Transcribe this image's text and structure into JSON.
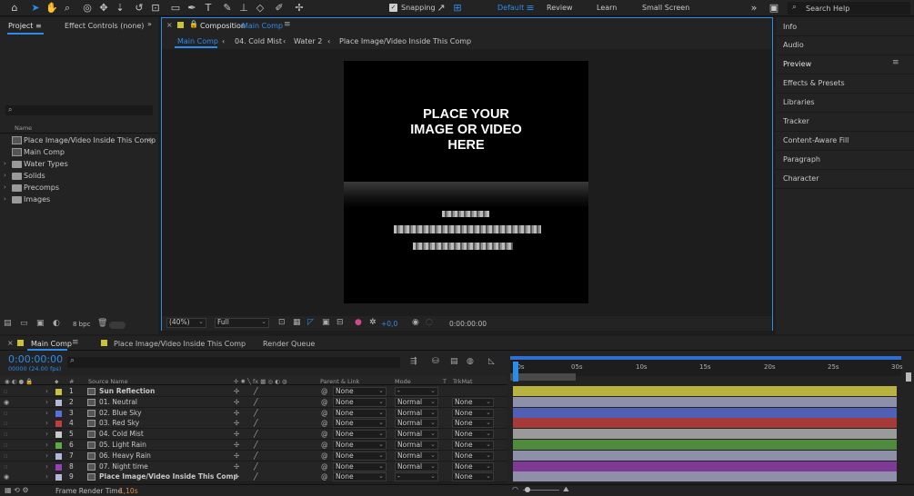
{
  "toolbar": {
    "snapping_label": "Snapping",
    "workspaces": [
      "Default",
      "Review",
      "Learn",
      "Small Screen"
    ],
    "search_placeholder": "Search Help"
  },
  "project": {
    "tab_project": "Project",
    "tab_effect_controls": "Effect Controls (none)",
    "column_name": "Name",
    "items": [
      {
        "label": "Place Image/Video Inside This Comp",
        "type": "comp"
      },
      {
        "label": "Main Comp",
        "type": "comp"
      },
      {
        "label": "Water Types",
        "type": "folder"
      },
      {
        "label": "Solids",
        "type": "folder"
      },
      {
        "label": "Precomps",
        "type": "folder"
      },
      {
        "label": "Images",
        "type": "folder"
      }
    ],
    "bpc": "8 bpc"
  },
  "composition": {
    "tab_prefix": "Composition",
    "tab_name": "Main Comp",
    "breadcrumbs": [
      "Main Comp",
      "04. Cold Mist",
      "Water 2",
      "Place Image/Video Inside This Comp"
    ],
    "placeholder_lines": [
      "PLACE YOUR",
      "IMAGE OR VIDEO",
      "HERE"
    ],
    "zoom": "(40%)",
    "resolution": "Full",
    "exposure": "+0,0",
    "timecode": "0:00:00:00"
  },
  "right_panels": [
    "Info",
    "Audio",
    "Preview",
    "Effects & Presets",
    "Libraries",
    "Tracker",
    "Content-Aware Fill",
    "Paragraph",
    "Character"
  ],
  "timeline": {
    "tabs": [
      "Main Comp",
      "Place Image/Video Inside This Comp",
      "Render Queue"
    ],
    "timecode": "0:00:00:00",
    "frames": "00000 (24.00 fps)",
    "ruler_labels": [
      "00s",
      "05s",
      "10s",
      "15s",
      "20s",
      "25s",
      "30s"
    ],
    "columns": {
      "hash": "#",
      "source_name": "Source Name",
      "parent": "Parent & Link",
      "mode": "Mode",
      "t": "T",
      "trkmat": "TrkMat"
    },
    "layers": [
      {
        "num": "1",
        "name": "Sun Reflection",
        "color": "#c9c23a",
        "parent": "None",
        "mode": "-",
        "trkmat": "",
        "bar": "#b8b23e",
        "eye": false,
        "bold": true
      },
      {
        "num": "2",
        "name": "01. Neutral",
        "color": "#b4b7d8",
        "parent": "None",
        "mode": "Normal",
        "trkmat": "None",
        "bar": "#8e8fa8",
        "eye": true,
        "bold": false
      },
      {
        "num": "3",
        "name": "02. Blue Sky",
        "color": "#5a6fd8",
        "parent": "None",
        "mode": "Normal",
        "trkmat": "None",
        "bar": "#5060b4",
        "eye": false,
        "bold": false
      },
      {
        "num": "4",
        "name": "03. Red Sky",
        "color": "#c33b3b",
        "parent": "None",
        "mode": "Normal",
        "trkmat": "None",
        "bar": "#a63a3a",
        "eye": false,
        "bold": false
      },
      {
        "num": "5",
        "name": "04. Cold Mist",
        "color": "#c9c9c9",
        "parent": "None",
        "mode": "Normal",
        "trkmat": "None",
        "bar": "#9a9a9a",
        "eye": false,
        "bold": false
      },
      {
        "num": "6",
        "name": "05. Light Rain",
        "color": "#5faa45",
        "parent": "None",
        "mode": "Normal",
        "trkmat": "None",
        "bar": "#4f8a3f",
        "eye": false,
        "bold": false
      },
      {
        "num": "7",
        "name": "06. Heavy Rain",
        "color": "#b4b7d8",
        "parent": "None",
        "mode": "Normal",
        "trkmat": "None",
        "bar": "#8e8fa8",
        "eye": false,
        "bold": false
      },
      {
        "num": "8",
        "name": "07. Night time",
        "color": "#9b3fb8",
        "parent": "None",
        "mode": "Normal",
        "trkmat": "None",
        "bar": "#7f3a96",
        "eye": false,
        "bold": false
      },
      {
        "num": "9",
        "name": "Place Image/Video Inside This Comp",
        "color": "#b4b7d8",
        "parent": "None",
        "mode": "-",
        "trkmat": "None",
        "bar": "#8e8fa8",
        "eye": true,
        "bold": true
      }
    ]
  },
  "status": {
    "label": "Frame Render Time",
    "value": "1,10s"
  }
}
